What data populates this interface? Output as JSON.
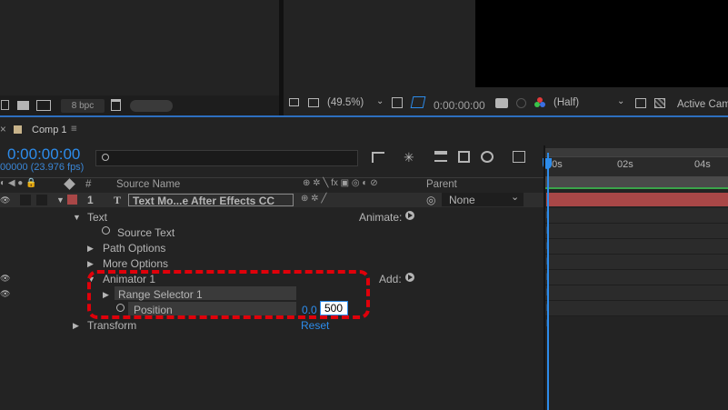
{
  "project": {
    "bpc_label": "8 bpc"
  },
  "viewer": {
    "zoom_value": "(49.5%)",
    "timecode": "0:00:00:00",
    "resolution_value": "(Half)",
    "camera_value": "Active Came"
  },
  "timeline": {
    "close_glyph": "×",
    "tab_label": "Comp 1",
    "menu_glyph": "≡",
    "current_time": "0:00:00:00",
    "fps_label": "00000 (23.976 fps)",
    "search_placeholder": "",
    "columns": {
      "number": "#",
      "source_name": "Source Name",
      "parent": "Parent"
    },
    "ruler": {
      "t0": "00s",
      "t1": "02s",
      "t2": "04s"
    },
    "layer": {
      "number": "1",
      "type_glyph": "T",
      "name": "Text Mo...e After Effects CC",
      "parent_value": "None"
    },
    "props": {
      "text": "Text",
      "animate_label": "Animate:",
      "source_text": "Source Text",
      "path_options": "Path Options",
      "more_options": "More Options",
      "animator": "Animator 1",
      "add_label": "Add:",
      "range_selector": "Range Selector 1",
      "position": "Position",
      "position_x": "0.0",
      "position_y": "500",
      "transform": "Transform",
      "reset": "Reset"
    },
    "highlight_color": "#e0000a",
    "accent_color": "#2d8ceb",
    "layer_bar_color": "#a94747"
  }
}
